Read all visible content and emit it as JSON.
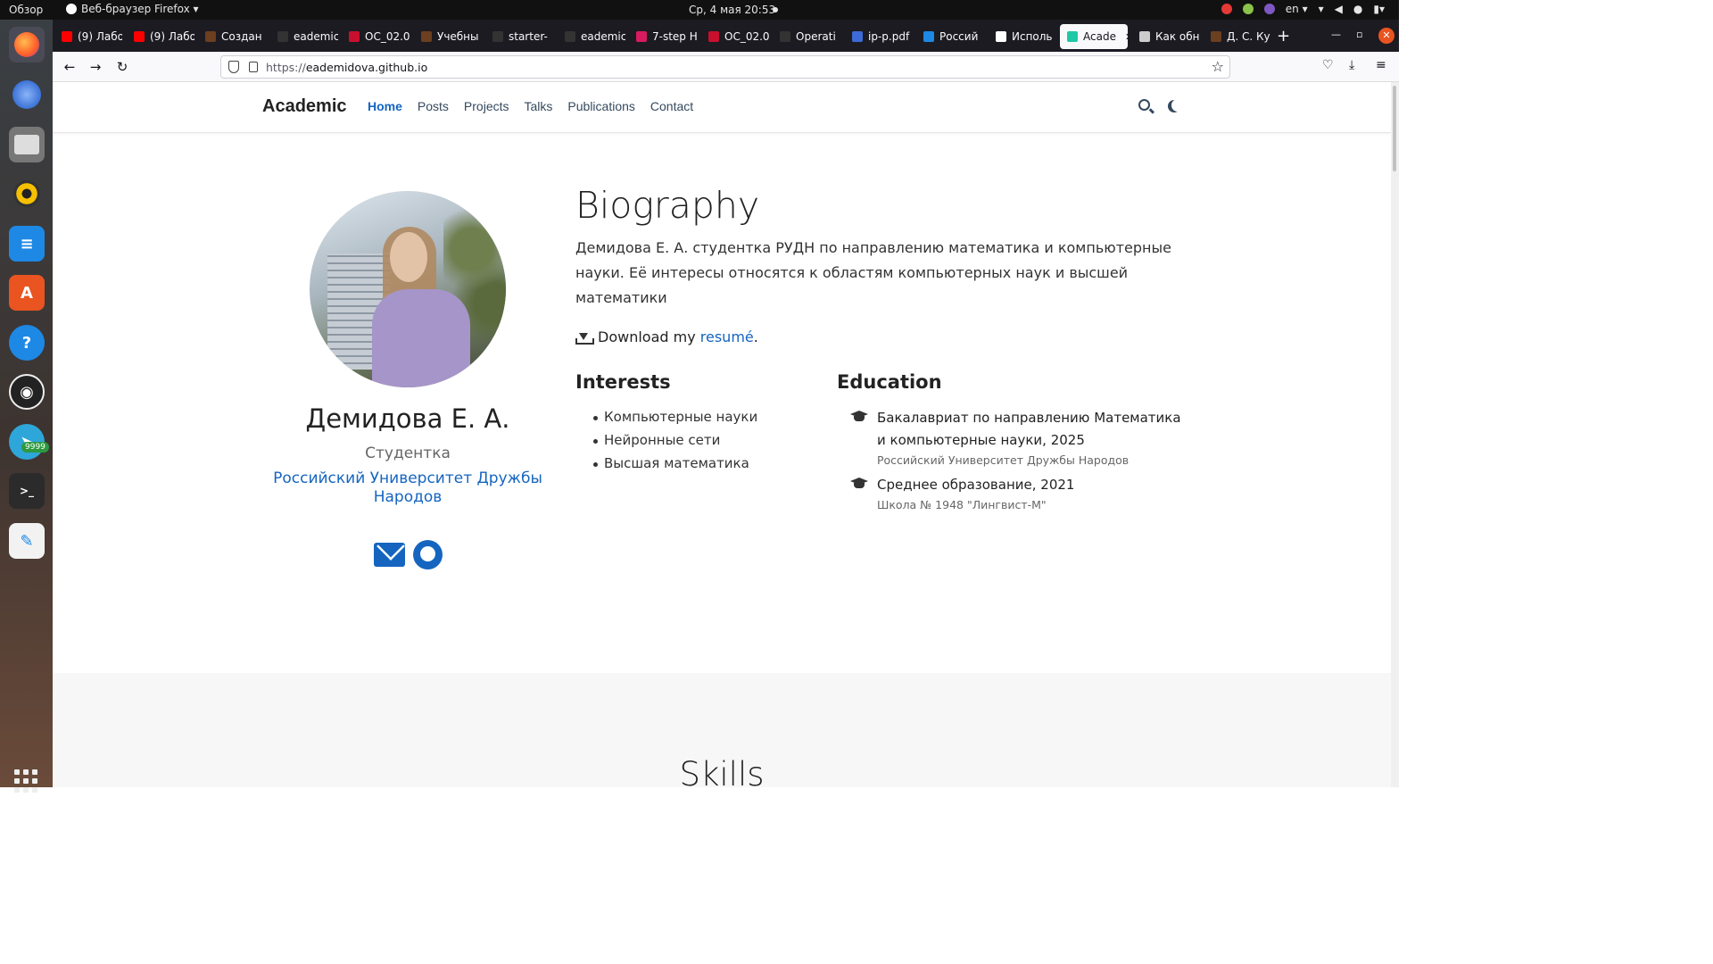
{
  "system": {
    "overview": "Обзор",
    "active_app": "Веб-браузер Firefox ▾",
    "clock": "Ср, 4 мая  20:53",
    "lang": "en ▾"
  },
  "browser": {
    "tabs": [
      {
        "label": "(9) Лабо",
        "color": "#ff0000"
      },
      {
        "label": "(9) Лабо",
        "color": "#ff0000"
      },
      {
        "label": "Создан",
        "color": "#6b3f1f"
      },
      {
        "label": "eademic",
        "color": "#333333"
      },
      {
        "label": "ОС_02.0",
        "color": "#c8102e"
      },
      {
        "label": "Учебны",
        "color": "#6b3f1f"
      },
      {
        "label": "starter-",
        "color": "#333333"
      },
      {
        "label": "eademic",
        "color": "#333333"
      },
      {
        "label": "7-step H",
        "color": "#d81b60"
      },
      {
        "label": "ОС_02.0",
        "color": "#c8102e"
      },
      {
        "label": "Operati",
        "color": "#333333"
      },
      {
        "label": "ip-p.pdf",
        "color": "#3d6ad6"
      },
      {
        "label": "Россий",
        "color": "#1e88e5"
      },
      {
        "label": "Исполь",
        "color": "#ffffff"
      },
      {
        "label": "Acade",
        "color": "#1ec8a5"
      },
      {
        "label": "Как обн",
        "color": "#cccccc"
      },
      {
        "label": "Д. С. Ку",
        "color": "#6b3f1f"
      }
    ],
    "active_tab_index": 14,
    "url_prefix": "https://",
    "url_host": "eademidova.github.io"
  },
  "site": {
    "brand": "Academic",
    "menu": [
      "Home",
      "Posts",
      "Projects",
      "Talks",
      "Publications",
      "Contact"
    ],
    "active_menu": "Home"
  },
  "profile": {
    "name": "Демидова Е. А.",
    "role": "Студентка",
    "organization": "Российский Университет Дружбы Народов"
  },
  "biography": {
    "title": "Biography",
    "text": "Демидова Е. А. студентка РУДН по направлению математика и компьютерные науки. Её интересы относятся к областям компьютерных наук и высшей математики",
    "download_prefix": "Download my",
    "download_link": "resumé",
    "download_suffix": "."
  },
  "interests": {
    "title": "Interests",
    "items": [
      "Компьютерные науки",
      "Нейронные сети",
      "Высшая математика"
    ]
  },
  "education": {
    "title": "Education",
    "items": [
      {
        "degree": "Бакалавриат по направлению Математика и компьютерные науки, 2025",
        "institution": "Российский Университет Дружбы Народов"
      },
      {
        "degree": "Среднее образование, 2021",
        "institution": "Школа № 1948 \"Лингвист-М\""
      }
    ]
  },
  "skills": {
    "title": "Skills"
  },
  "dock": {
    "telegram_badge": "9999"
  }
}
